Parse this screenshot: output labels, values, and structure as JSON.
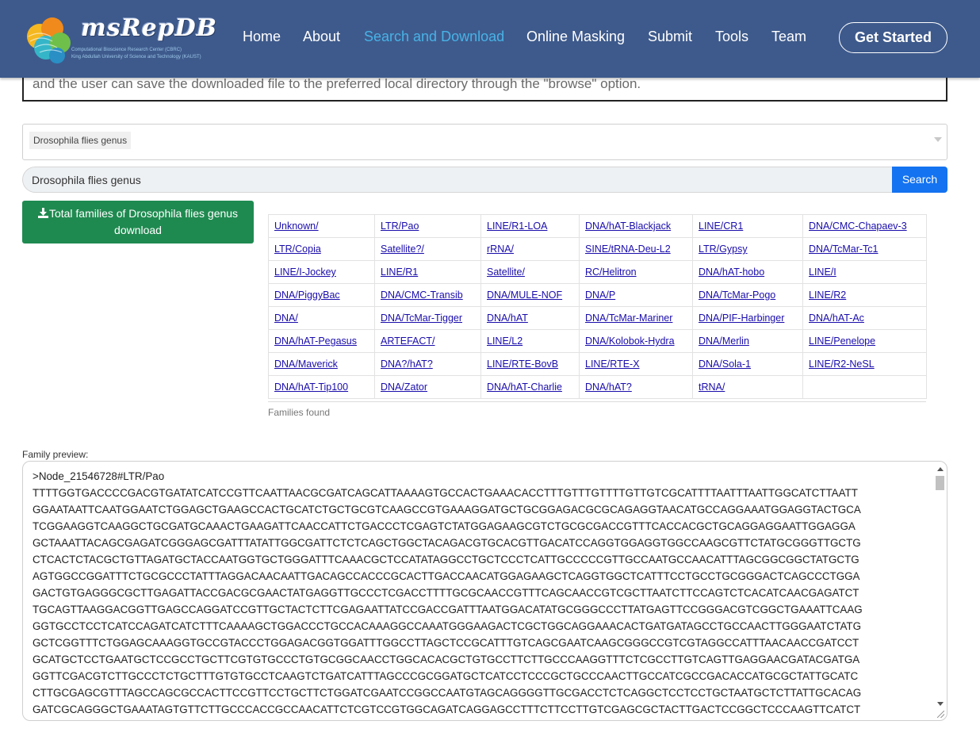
{
  "navbar": {
    "logo": {
      "title": "msRepDB",
      "subtitle_1": "Computational Bioscience Research Center (CBRC)",
      "subtitle_2": "King Abdullah University of Science and Technology (KAUST)"
    },
    "items": [
      "Home",
      "About",
      "Search and Download",
      "Online Masking",
      "Submit",
      "Tools",
      "Team"
    ],
    "active_item": "Search and Download",
    "cta_label": "Get Started"
  },
  "info_text": "and the user can save the downloaded file to the preferred local directory through the \"browse\" option.",
  "select": {
    "selected": "Drosophila flies genus"
  },
  "search": {
    "value": "Drosophila flies genus",
    "button_label": "Search"
  },
  "download": {
    "line1": "Total families of Drosophila flies genus",
    "line2": "download"
  },
  "families_table": {
    "rows": [
      [
        "Unknown/",
        "LTR/Pao",
        "LINE/R1-LOA",
        "DNA/hAT-Blackjack",
        "LINE/CR1",
        "DNA/CMC-Chapaev-3"
      ],
      [
        "LTR/Copia",
        "Satellite?/",
        "rRNA/",
        "SINE/tRNA-Deu-L2",
        "LTR/Gypsy",
        "DNA/TcMar-Tc1"
      ],
      [
        "LINE/I-Jockey",
        "LINE/R1",
        "Satellite/",
        "RC/Helitron",
        "DNA/hAT-hobo",
        "LINE/I"
      ],
      [
        "DNA/PiggyBac",
        "DNA/CMC-Transib",
        "DNA/MULE-NOF",
        "DNA/P",
        "DNA/TcMar-Pogo",
        "LINE/R2"
      ],
      [
        "DNA/",
        "DNA/TcMar-Tigger",
        "DNA/hAT",
        "DNA/TcMar-Mariner",
        "DNA/PIF-Harbinger",
        "DNA/hAT-Ac"
      ],
      [
        "DNA/hAT-Pegasus",
        "ARTEFACT/",
        "LINE/L2",
        "DNA/Kolobok-Hydra",
        "DNA/Merlin",
        "LINE/Penelope"
      ],
      [
        "DNA/Maverick",
        "DNA?/hAT?",
        "LINE/RTE-BovB",
        "LINE/RTE-X",
        "DNA/Sola-1",
        "LINE/R2-NeSL"
      ],
      [
        "DNA/hAT-Tip100",
        "DNA/Zator",
        "DNA/hAT-Charlie",
        "DNA/hAT?",
        "tRNA/",
        ""
      ]
    ],
    "footer": "Families found"
  },
  "preview": {
    "label": "Family preview:",
    "lines": [
      ">Node_21546728#LTR/Pao",
      "TTTTGGTGACCCCGACGTGATATCATCCGTTCAATTAACGCGATCAGCATTAAAAGTGCCACTGAAACACCTTTGTTTGTTTTGTTGTCGCATTTTAATTTAATTGGCATCTTAATT",
      "GGAATAATTCAATGGAATCTGGAGCTGAAGCCACTGCATCTGCTGCGTCAAGCCGTGAAAGGATGCTGCGGAGACGCGCAGAGGTAACATGCCAGGAAATGGAGGTACTGCA",
      "TCGGAAGGTCAAGGCTGCGATGCAAACTGAAGATTCAACCATTCTGACCCTCGAGTCTATGGAGAAGCGTCTGCGCGACCGTTTCACCACGCTGCAGGAGGAATTGGAGGA",
      "GCTAAATTACAGCGAGATCGGGAGCGATTTATATTGGCGATTCTCTCAGCTGGCTACAGACGTGCACGTTGACATCCAGGTGGAGGTGGCCAAGCGTTCTATGCGGGTTGCTG",
      "CTCACTCTACGCTGTTAGATGCTACCAATGGTGCTGGGATTTCAAACGCTCCATATAGGCCTGCTCCCTCATTGCCCCCGTTGCCAATGCCAACATTTAGCGGCGGCTATGCTG",
      "AGTGGCCGGATTTCTGCGCCCTATTTAGGACAACAATTGACAGCCACCCGCACTTGACCAACATGGAGAAGCTCAGGTGGCTCATTTCCTGCCTGCGGGACTCAGCCCTGGA",
      "GACTGTGAGGGCGCTTGAGATTACCGACGCGAACTATGAGGTTGCCCTCGACCTTTTGCGCAACCGTTTCAGCAACCGTCGCTTAATCTTCCAGTCTCACATCAACGAGATCT",
      "TGCAGTTAAGGACGGTTGAGCCAGGATCCGTTGCTACTCTTCGAGAATTATCCGACCGATTTAATGGACATATGCGGGCCCTTATGAGTTCCGGGACGTCGGCTGAAATTCAAG",
      "GGTGCCTCCTCATCCAGATCATCTTTCAAAAGCTGGACCCTGCCACAAAGGCCAAATGGGAAGACTCGCTGGCAGGAAACACTGATGATAGCCTGCCAACTTGGGAATCTATG",
      "GCTCGGTTTCTGGAGCAAAGGTGCCGTACCCTGGAGACGGTGGATTTGGCCTTAGCTCCGCATTTGTCAGCGAATCAAGCGGGCCGTCGTAGGCCATTTAACAACCGATCCT",
      "GCATGCTCCTGAATGCTCCGCCTGCTTCGTGTGCCCTGTGCGGCAACCTGGCACACGCTGTGCCTTCTTGCCCAAGGTTTCTCGCCTTGTCAGTTGAGGAACGATACGATGA",
      "GGTTCGACGTCTTGCCCTCTGCTTTGTGTGCCTCAAGTCTGATCATTTAGCCCGCGGATGCTCATCCTCCCGCTGCCCAACTTGCCATCGCCGACACCATGCGCTATTGCATC",
      "CTTGCGAGCGTTTAGCCAGCGCCACTTCCGTTCCTGCTTCTGGATCGAATCCGGCCAATGTAGCAGGGGTTGCGACCTCTCAGGCTCCTCCTGCTAATGCTCTTATTGCACAG",
      "GATCGCAGGGCTGAAATAGTGTTCTTGCCCACCGCCAACATTCTCGTCCGTGGCAGATCAGGAGCCTTTCTTCCTTGTCGAGCGCTACTTGACTCCGGCTCCCAAGTTCATCT"
    ]
  }
}
